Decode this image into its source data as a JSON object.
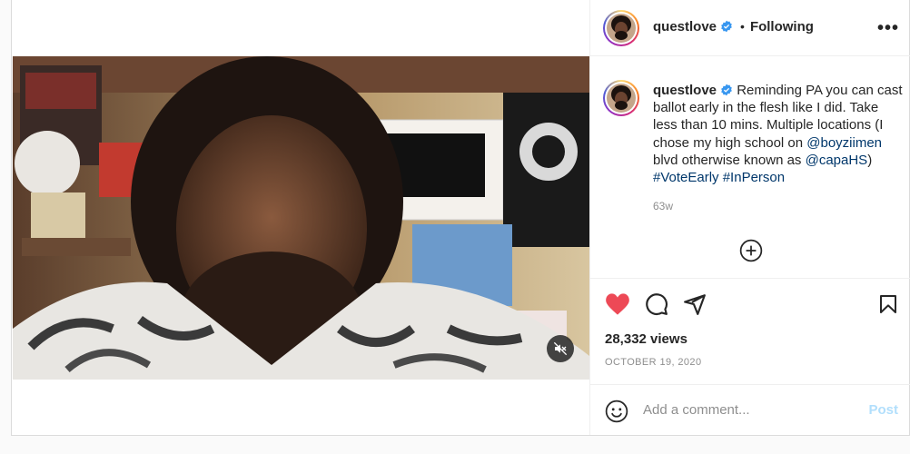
{
  "post": {
    "username": "questlove",
    "follow_separator": "•",
    "follow_status": "Following",
    "more_label": "•••",
    "caption_user": "questlove",
    "caption_text_1": "Reminding PA you can cast ballot early in the flesh like I did. Take less than 10 mins. Multiple locations (I chose my high school on ",
    "mention_1": "@boyziimen",
    "caption_text_2": " blvd otherwise known as ",
    "mention_2": "@capaHS",
    "caption_text_3": ") ",
    "hashtag_1": "#VoteEarly",
    "hashtag_2": "#InPerson",
    "relative_time": "63w",
    "views": "28,332 views",
    "date": "OCTOBER 19, 2020",
    "liked": true
  },
  "comment": {
    "placeholder": "Add a comment...",
    "post_label": "Post"
  },
  "icons": {
    "verified": "verified-badge-icon",
    "mute": "speaker-muted-icon",
    "add": "plus-circle-icon",
    "like": "heart-icon",
    "comment": "comment-bubble-icon",
    "share": "paper-plane-icon",
    "save": "bookmark-icon",
    "emoji": "smiley-icon"
  },
  "colors": {
    "like_red": "#ed4956",
    "verified_blue": "#3897f0",
    "link_blue": "#00376b",
    "post_disabled": "#b2dffc"
  }
}
